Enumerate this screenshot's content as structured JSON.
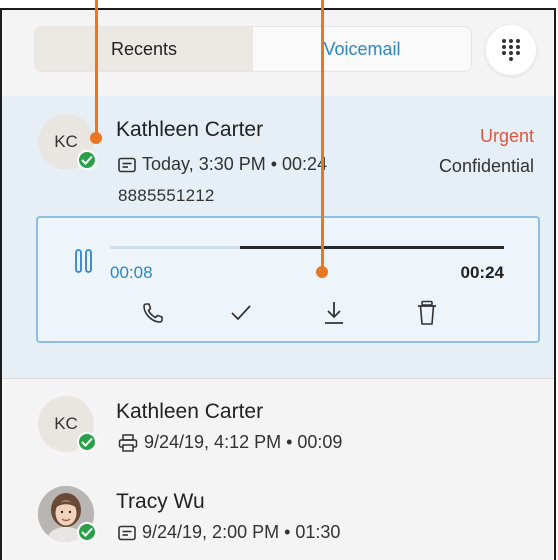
{
  "tabs": {
    "recents": "Recents",
    "voicemail": "Voicemail"
  },
  "dialpad": {
    "icon": "dialpad-icon"
  },
  "selected_entry": {
    "initials": "KC",
    "name": "Kathleen Carter",
    "meta": "Today, 3:30 PM • 00:24",
    "phone": "8885551212",
    "urgent": "Urgent",
    "confidential": "Confidential",
    "player": {
      "current_time": "00:08",
      "total_time": "00:24",
      "progress": 0.33
    }
  },
  "entries": [
    {
      "initials": "KC",
      "name": "Kathleen Carter",
      "meta": "9/24/19, 4:12 PM • 00:09",
      "icon": "printer-icon"
    },
    {
      "initials": "",
      "name": "Tracy Wu",
      "meta": "9/24/19, 2:00 PM • 01:30",
      "icon": "voicemail-box-icon"
    }
  ],
  "colors": {
    "accent": "#2b86c9",
    "urgent": "#e0553b",
    "presence": "#2ba04a",
    "callout": "#e87722",
    "selected_bg": "#e5eff5"
  }
}
